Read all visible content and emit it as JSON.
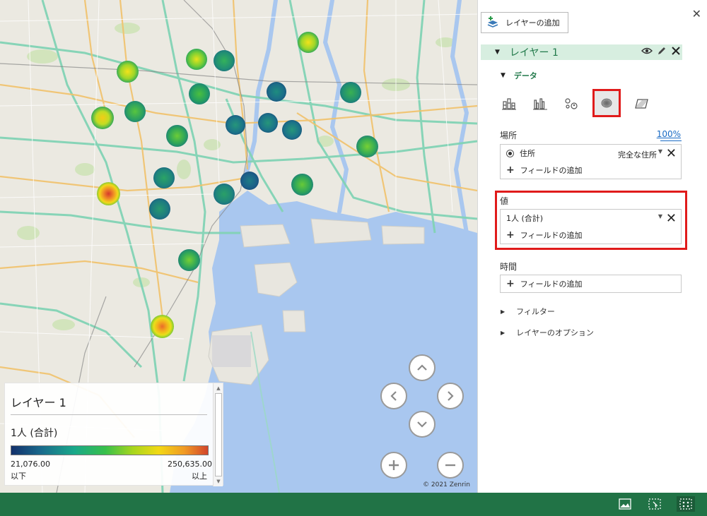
{
  "map": {
    "copyright": "© 2021 Zenrin"
  },
  "hotspots": [
    {
      "intensity": "yellow"
    },
    {
      "intensity": "yellow"
    },
    {
      "intensity": "yellow"
    },
    {
      "intensity": "teal"
    },
    {
      "intensity": "yellow"
    },
    {
      "intensity": "green"
    },
    {
      "intensity": "teal"
    },
    {
      "intensity": "green"
    },
    {
      "intensity": "green"
    },
    {
      "intensity": "green"
    },
    {
      "intensity": "teal"
    },
    {
      "intensity": "teal"
    },
    {
      "intensity": "teal"
    },
    {
      "intensity": "red"
    },
    {
      "intensity": "teal"
    },
    {
      "intensity": "green"
    },
    {
      "intensity": "teal"
    },
    {
      "intensity": "teal"
    },
    {
      "intensity": "green"
    },
    {
      "intensity": "green"
    },
    {
      "intensity": "green"
    },
    {
      "intensity": "orange"
    },
    {
      "intensity": "teal"
    }
  ],
  "legend": {
    "layer_name": "レイヤー 1",
    "field": "1人 (合計)",
    "min_value": "21,076.00",
    "max_value": "250,635.00",
    "min_label": "以下",
    "max_label": "以上"
  },
  "panel": {
    "add_layer_label": "レイヤーの追加",
    "layer_name": "レイヤー 1",
    "data_section": "データ",
    "location_label": "場所",
    "location_percent": "100%",
    "location_field": "住所",
    "location_type": "完全な住所",
    "add_field_label": "フィールドの追加",
    "value_label": "値",
    "value_field": "1人 (合計)",
    "value_add_field": "フィールドの追加",
    "time_label": "時間",
    "time_add_field": "フィールドの追加",
    "filter_label": "フィルター",
    "layer_options_label": "レイヤーのオプション",
    "chart_types": [
      "stacked-column-icon",
      "clustered-column-icon",
      "bubble-icon",
      "heatmap-icon",
      "region-icon"
    ],
    "selected_chart_type": "heatmap-icon"
  },
  "colors": {
    "accent": "#217346",
    "layer_green": "#21794a",
    "highlight_red": "#e01b1b",
    "water": "#a9c7ef"
  }
}
